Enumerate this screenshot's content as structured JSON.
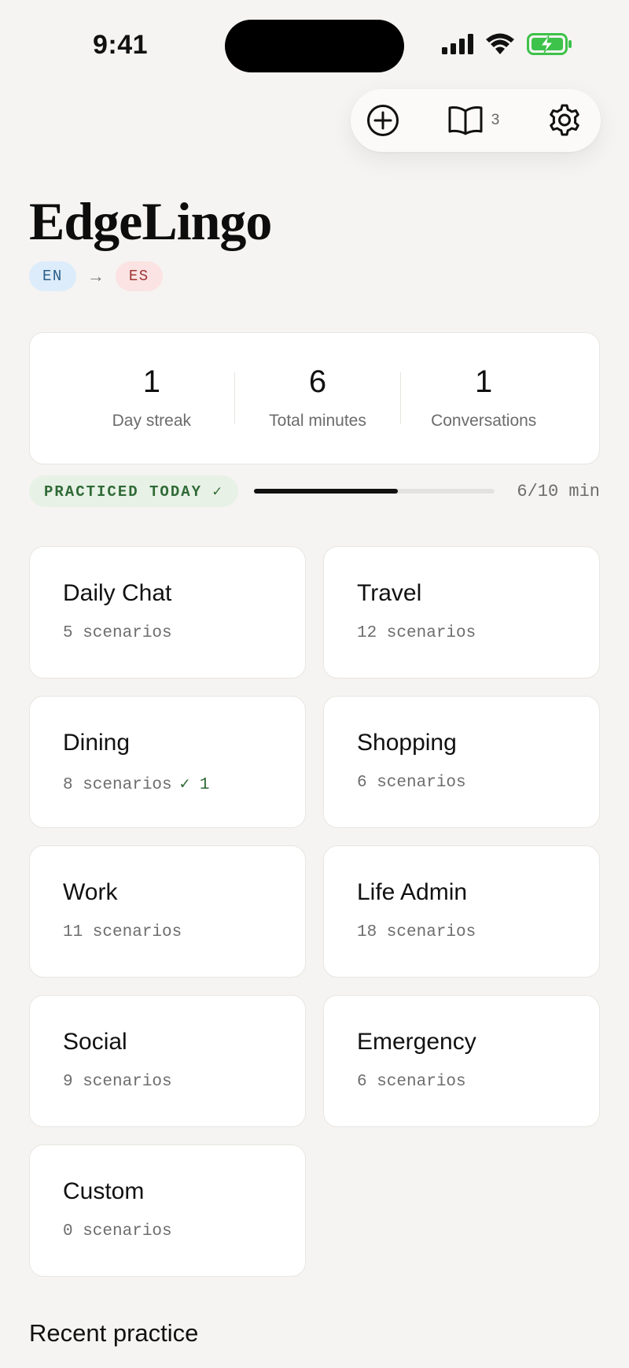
{
  "status_bar": {
    "time": "9:41"
  },
  "toolbar": {
    "saved_count": "3"
  },
  "header": {
    "title": "EdgeLingo",
    "lang_from": "EN",
    "lang_to": "ES",
    "arrow": "→"
  },
  "stats": [
    {
      "value": "1",
      "label": "Day streak"
    },
    {
      "value": "6",
      "label": "Total minutes"
    },
    {
      "value": "1",
      "label": "Conversations"
    }
  ],
  "progress": {
    "badge": "PRACTICED TODAY ✓",
    "text": "6/10 min",
    "fraction": 0.6
  },
  "categories": [
    {
      "name": "Daily Chat",
      "meta": "5 scenarios",
      "done": ""
    },
    {
      "name": "Travel",
      "meta": "12 scenarios",
      "done": ""
    },
    {
      "name": "Dining",
      "meta": "8 scenarios",
      "done": "✓ 1"
    },
    {
      "name": "Shopping",
      "meta": "6 scenarios",
      "done": ""
    },
    {
      "name": "Work",
      "meta": "11 scenarios",
      "done": ""
    },
    {
      "name": "Life Admin",
      "meta": "18 scenarios",
      "done": ""
    },
    {
      "name": "Social",
      "meta": "9 scenarios",
      "done": ""
    },
    {
      "name": "Emergency",
      "meta": "6 scenarios",
      "done": ""
    },
    {
      "name": "Custom",
      "meta": "0 scenarios",
      "done": ""
    }
  ],
  "recent": {
    "title": "Recent practice"
  },
  "colors": {
    "background": "#f5f4f2",
    "practiced_green": "#2f6a36",
    "battery_green": "#3dc24a",
    "lang_from_bg": "#dcecfa",
    "lang_to_bg": "#fbe3e3"
  },
  "icons": [
    "signal-icon",
    "wifi-icon",
    "battery-charging-icon",
    "plus-circle-icon",
    "book-icon",
    "gear-icon"
  ]
}
